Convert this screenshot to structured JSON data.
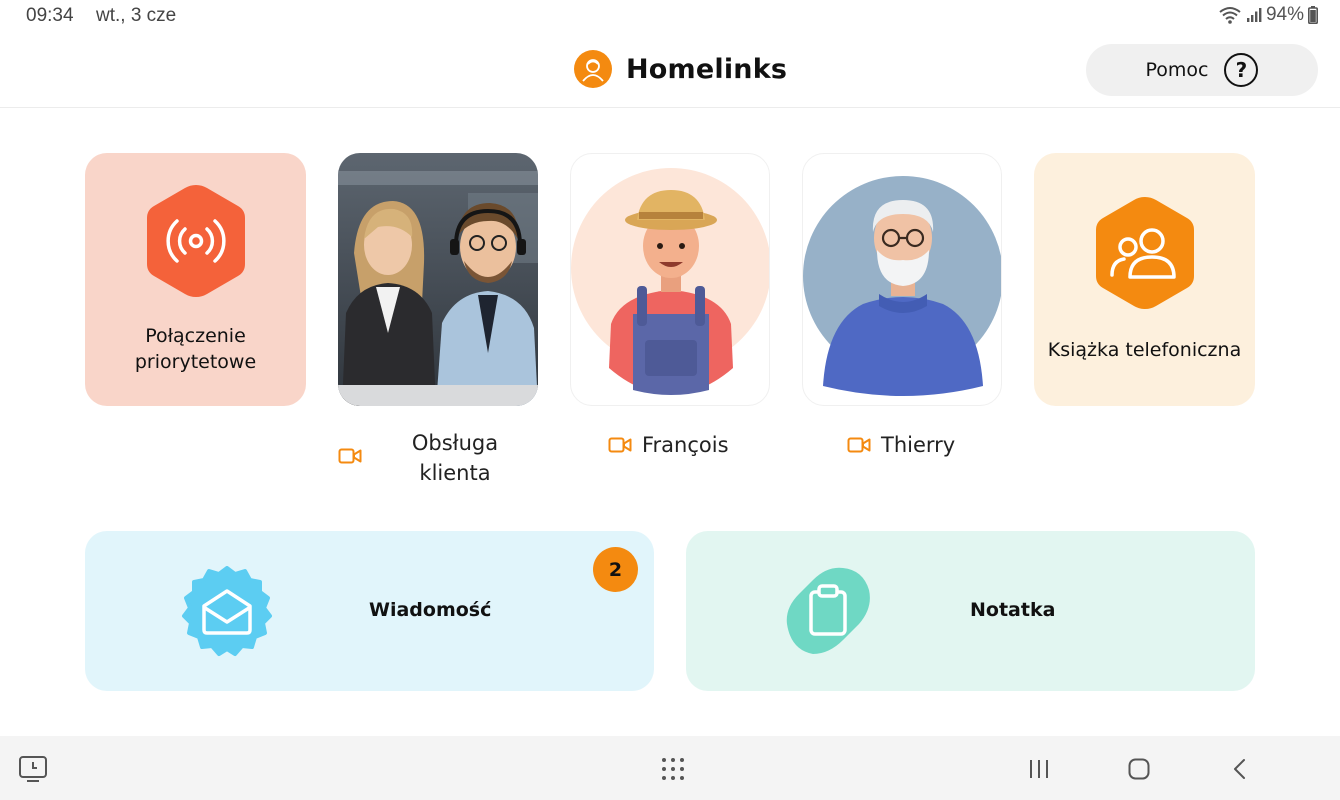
{
  "status_bar": {
    "time": "09:34",
    "date": "wt., 3 cze",
    "battery": "94%"
  },
  "header": {
    "title": "Homelinks",
    "help_label": "Pomoc",
    "help_glyph": "?"
  },
  "tiles": {
    "priority_line1": "Połączenie",
    "priority_line2": "priorytetowe",
    "phonebook_label": "Książka telefoniczna"
  },
  "contacts": [
    {
      "name_line1": "Obsługa",
      "name_line2": "klienta",
      "icon": "video-camera-icon"
    },
    {
      "name": "François",
      "icon": "video-camera-icon"
    },
    {
      "name": "Thierry",
      "icon": "video-camera-icon"
    }
  ],
  "cards": {
    "messages_label": "Wiadomość",
    "messages_badge": "2",
    "notes_label": "Notatka"
  },
  "colors": {
    "accent": "#f48a10",
    "priority_tile": "#f9d5c9",
    "priority_hex": "#f4623a",
    "phonebook_tile": "#fdf0dd",
    "messages_card": "#e1f5fb",
    "messages_icon": "#5ccdf2",
    "notes_card": "#e2f6f1",
    "notes_icon": "#6fd8c4"
  }
}
